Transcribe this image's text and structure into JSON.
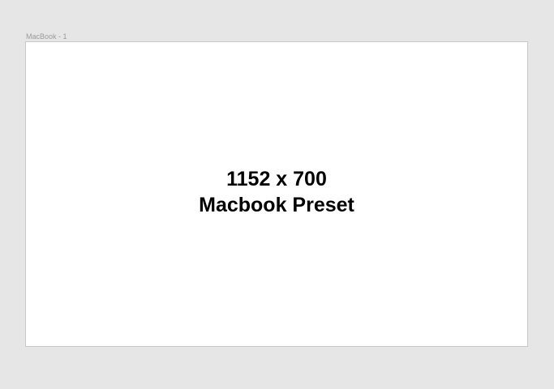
{
  "frame": {
    "label": "MacBook - 1",
    "dimensions_text": "1152 x 700",
    "preset_text": "Macbook Preset"
  },
  "colors": {
    "canvas_background": "#e6e6e6",
    "frame_background": "#ffffff",
    "frame_border": "#c8c8c8",
    "label_text": "#9a9a9a",
    "body_text": "#000000"
  }
}
